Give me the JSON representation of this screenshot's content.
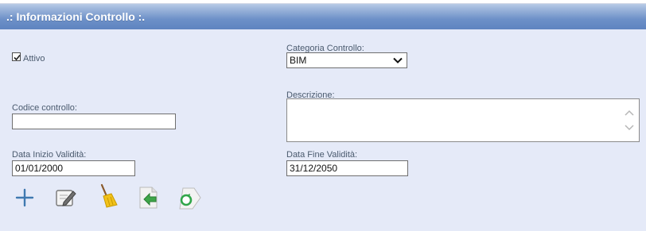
{
  "header": {
    "title": ".: Informazioni Controllo :."
  },
  "form": {
    "attivo_label": "Attivo",
    "attivo_checked": true,
    "categoria_label": "Categoria Controllo:",
    "categoria_value": "BIM",
    "codice_label": "Codice controllo:",
    "codice_value": "",
    "descrizione_label": "Descrizione:",
    "descrizione_value": "",
    "data_inizio_label": "Data Inizio Validità:",
    "data_inizio_value": "01/01/2000",
    "data_fine_label": "Data Fine Validità:",
    "data_fine_value": "31/12/2050"
  },
  "toolbar": {
    "icons": [
      "add-icon",
      "edit-icon",
      "clear-broom-icon",
      "back-arrow-icon",
      "refresh-icon"
    ]
  },
  "colors": {
    "header_bg": "#6d90c8",
    "panel_bg": "#e5eaf8",
    "label_text": "#4a5a6e"
  }
}
